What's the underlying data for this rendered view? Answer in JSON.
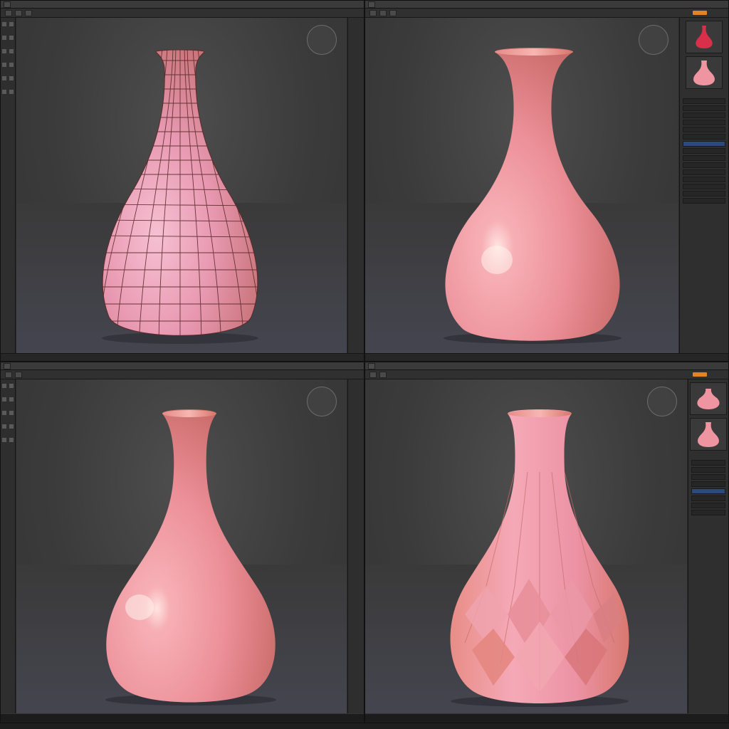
{
  "colors": {
    "ui_bg": "#2a2a2a",
    "viewport_bg": "#3e3e3e",
    "accent": "#e28422",
    "vase_light": "#f3a3b8",
    "vase_mid": "#ec8f8a",
    "vase_shadow": "#d8756a",
    "wire": "#5a2a2a",
    "selection": "#2d4b79"
  },
  "icons": {
    "nav_cube": "nav-cube-icon",
    "tool": "tool-icon",
    "material_preview": "vase-thumbnail-icon"
  },
  "panels": {
    "top_left": {
      "view": "wireframe-vase"
    },
    "top_right": {
      "view": "smooth-vase"
    },
    "bottom_left": {
      "view": "smooth-vase"
    },
    "bottom_right": {
      "view": "faceted-vase"
    }
  }
}
